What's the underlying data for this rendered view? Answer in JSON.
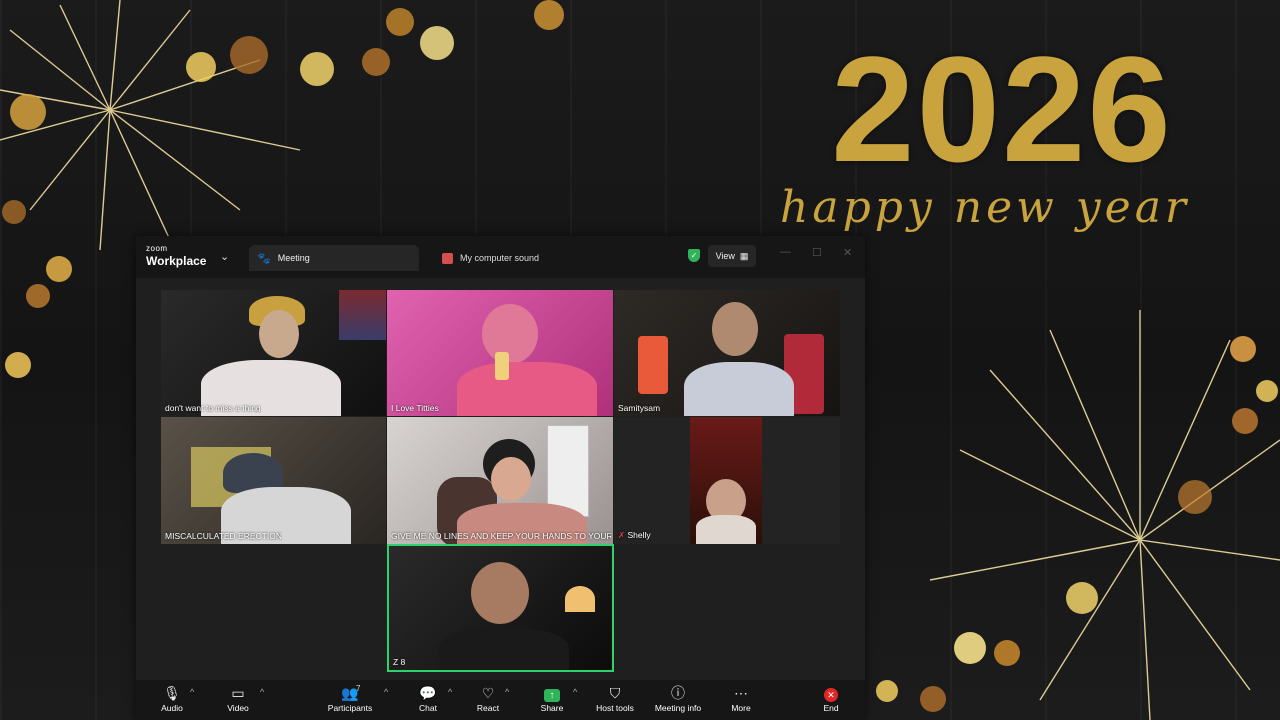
{
  "background": {
    "year": "2026",
    "greeting": "happy new year",
    "gold": "#c9a43e"
  },
  "window": {
    "brand_top": "zoom",
    "brand_bottom": "Workplace",
    "tabs": [
      {
        "label": "Meeting",
        "icon": "paw-icon"
      },
      {
        "label": "My computer sound",
        "icon": "sound-icon"
      }
    ],
    "view_label": "View"
  },
  "participants": [
    {
      "name": "don't want to miss a thing"
    },
    {
      "name": "I Love Titties"
    },
    {
      "name": "Samitysam"
    },
    {
      "name": "MISCALCULATED ERECTION"
    },
    {
      "name": "GIVE ME NO LINES AND KEEP YOUR HANDS TO YOUR..."
    },
    {
      "name": "Shelly"
    },
    {
      "name": "Z 8"
    }
  ],
  "toolbar": {
    "audio": "Audio",
    "video": "Video",
    "participants": "Participants",
    "participants_count": "7",
    "chat": "Chat",
    "react": "React",
    "share": "Share",
    "host_tools": "Host tools",
    "meeting_info": "Meeting info",
    "more": "More",
    "end": "End"
  }
}
